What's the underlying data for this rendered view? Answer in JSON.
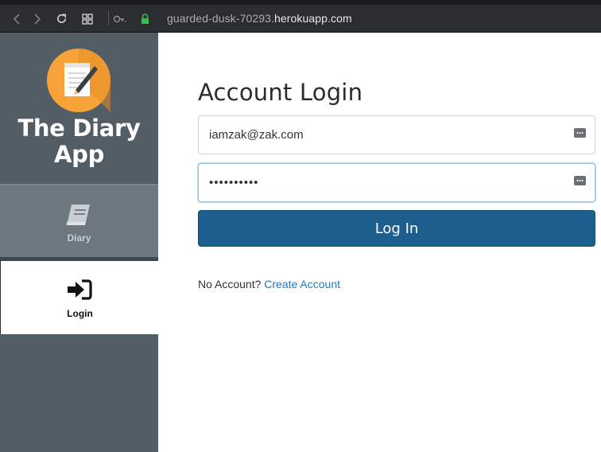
{
  "browser": {
    "url_prefix": "guarded-dusk-70293.",
    "url_host": "herokuapp.com",
    "icons": [
      "back-icon",
      "forward-icon",
      "reload-icon",
      "tabs-grid-icon",
      "key-icon",
      "lock-icon"
    ]
  },
  "sidebar": {
    "brand_line1": "The Diary",
    "brand_line2": "App",
    "logo_icon": "notepad-pencil-icon",
    "items": [
      {
        "label": "Diary",
        "icon": "book-icon",
        "active": false
      },
      {
        "label": "Login",
        "icon": "sign-in-icon",
        "active": true
      }
    ]
  },
  "main": {
    "title": "Account Login",
    "email_value": "iamzak@zak.com",
    "password_value": "••••••••••",
    "login_button": "Log In",
    "no_account_text": "No Account?",
    "create_account_link": "Create Account"
  },
  "colors": {
    "sidebar_bg": "#525d66",
    "logo_bg": "#f7a33a",
    "button_bg": "#1c5e8e",
    "link": "#1f79b8"
  }
}
